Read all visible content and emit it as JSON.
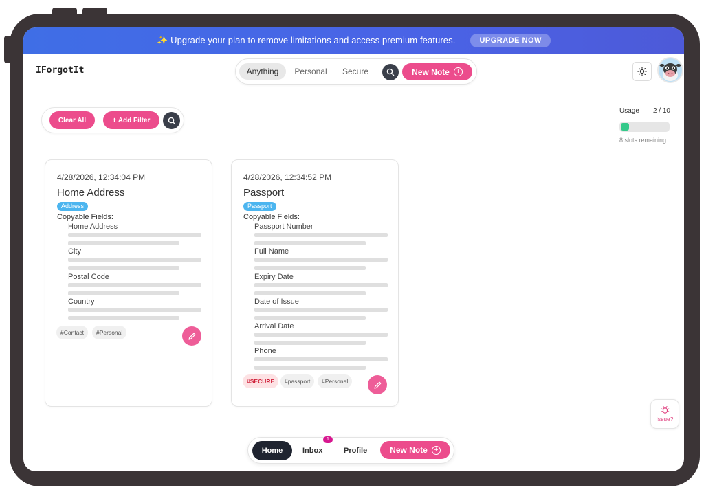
{
  "banner": {
    "text": "✨ Upgrade your plan to remove limitations and access premium features.",
    "button": "UPGRADE NOW"
  },
  "header": {
    "logo": "IForgotIt",
    "tabs": [
      "Anything",
      "Personal",
      "Secure"
    ],
    "active_tab": "Anything",
    "new_note": "New Note",
    "search_icon": "search-icon",
    "theme_icon": "sun-icon",
    "avatar_icon": "cow-avatar"
  },
  "filters": {
    "clear_all": "Clear All",
    "add_filter": "+ Add Filter",
    "search_icon": "search-icon"
  },
  "usage": {
    "label": "Usage",
    "count": "2 / 10",
    "used": 2,
    "total": 10,
    "remaining": "8 slots remaining",
    "bar_color": "#34c98a"
  },
  "cards": [
    {
      "date": "4/28/2026, 12:34:04 PM",
      "title": "Home Address",
      "tag": "Address",
      "fields_label": "Copyable Fields:",
      "fields": [
        "Home Address",
        "City",
        "Postal Code",
        "Country"
      ],
      "hashtags": [
        "#Contact",
        "#Personal"
      ]
    },
    {
      "date": "4/28/2026, 12:34:52 PM",
      "title": "Passport",
      "tag": "Passport",
      "fields_label": "Copyable Fields:",
      "fields": [
        "Passport Number",
        "Full Name",
        "Expiry Date",
        "Date of Issue",
        "Arrival Date",
        "Phone"
      ],
      "hashtags": [
        "#SECURE",
        "#passport",
        "#Personal"
      ]
    }
  ],
  "issue": {
    "label": "Issue?",
    "icon": "bug-icon"
  },
  "bottom_nav": {
    "home": "Home",
    "inbox": "Inbox",
    "inbox_badge": "1",
    "profile": "Profile",
    "new_note": "New Note"
  },
  "colors": {
    "accent_pink": "#ec4c8c",
    "banner_blue": "#4a63e6",
    "tag_blue": "#4cb5ef",
    "dark": "#1f2430"
  }
}
